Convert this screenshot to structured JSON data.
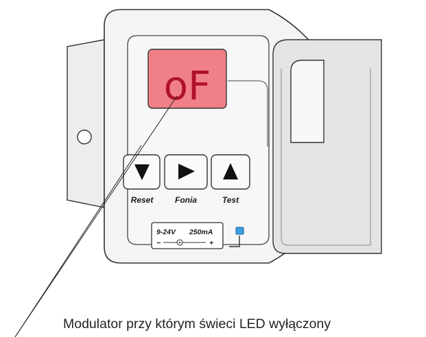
{
  "device": {
    "display": {
      "text": "oF",
      "color": "#f08088",
      "text_color": "#b0122a"
    },
    "buttons": [
      {
        "label": "Reset",
        "icon": "triangle-down-icon"
      },
      {
        "label": "Fonia",
        "icon": "triangle-right-icon"
      },
      {
        "label": "Test",
        "icon": "triangle-up-icon"
      }
    ],
    "power": {
      "voltage": "9-24V",
      "current": "250mA",
      "minus": "−",
      "plus": "+"
    },
    "led": {
      "state": "off",
      "color": "#3aa0e6"
    }
  },
  "caption": "Modulator przy którym świeci LED wyłączony"
}
